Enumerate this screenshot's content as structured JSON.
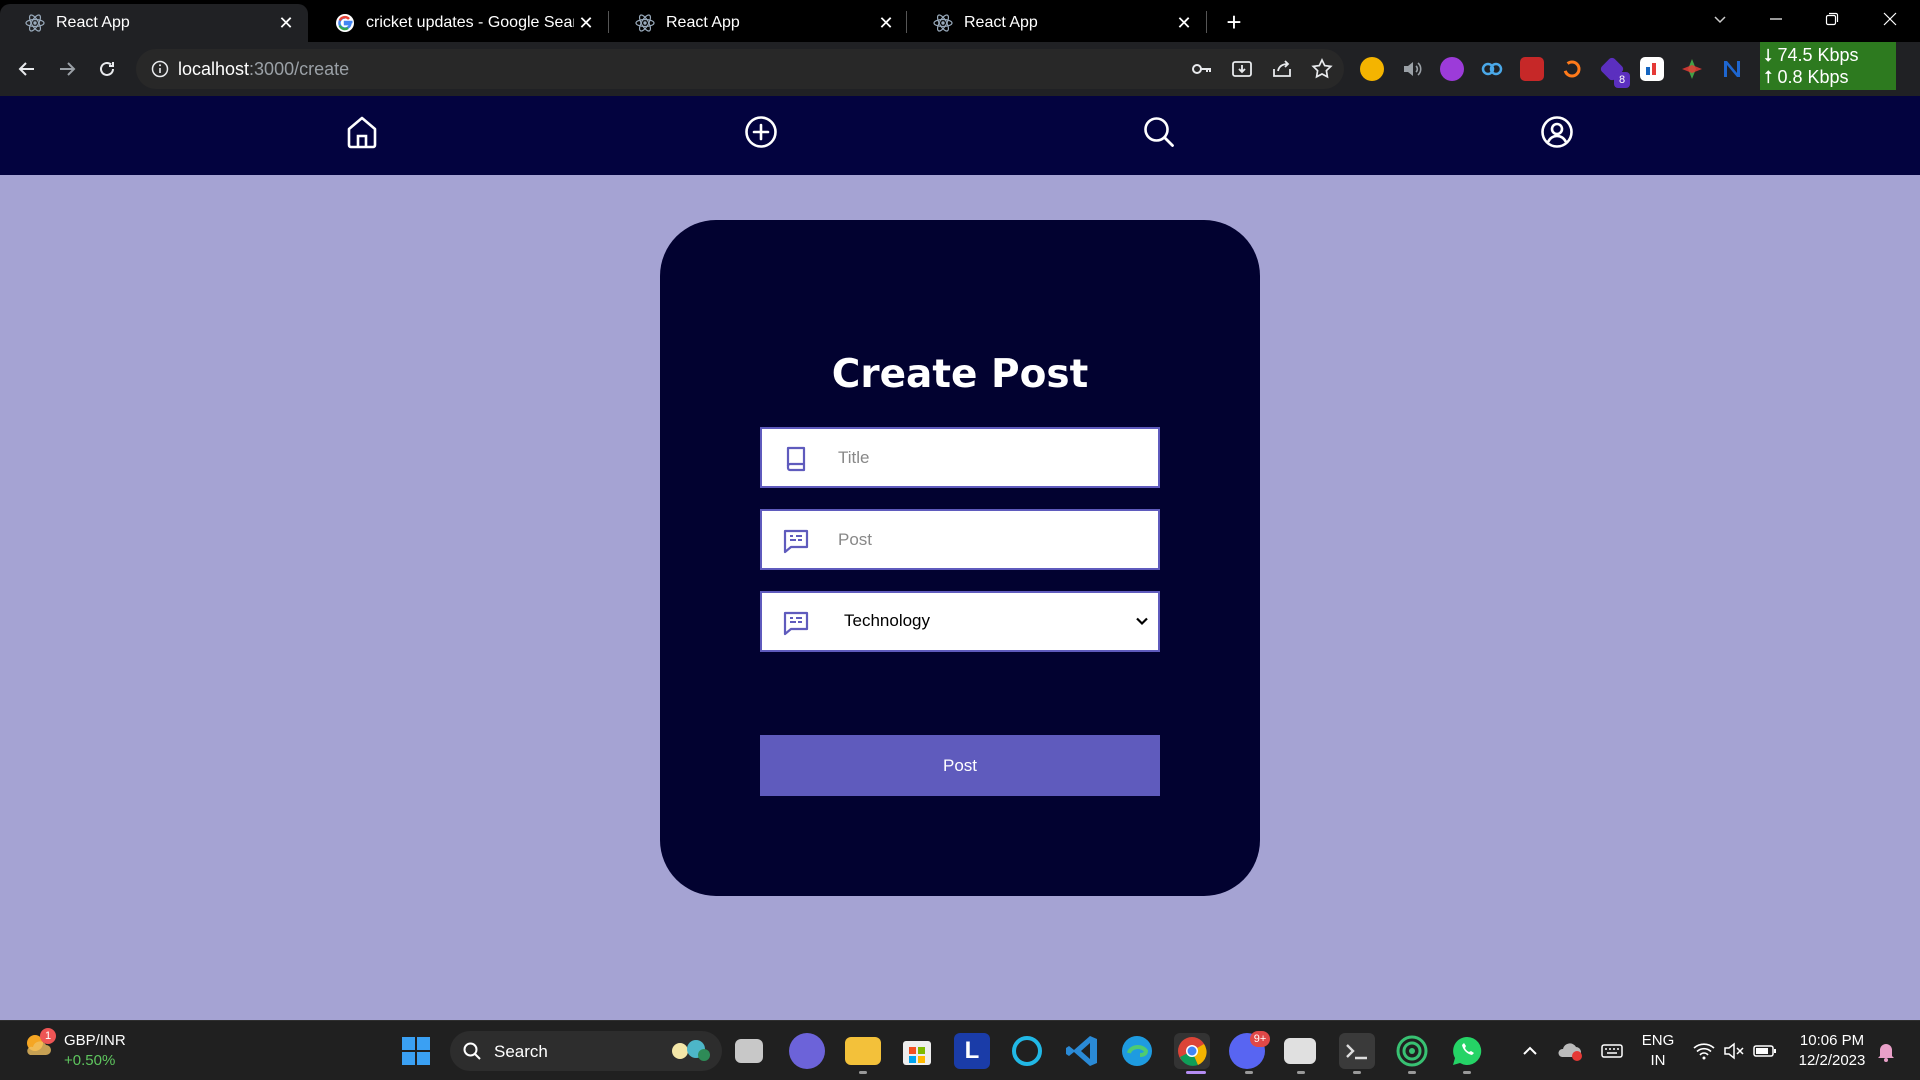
{
  "browser": {
    "tabs": [
      {
        "title": "React App",
        "icon": "react-icon",
        "active": true
      },
      {
        "title": "cricket updates - Google Search",
        "icon": "google-icon",
        "active": false
      },
      {
        "title": "React App",
        "icon": "react-icon",
        "active": false
      },
      {
        "title": "React App",
        "icon": "react-icon",
        "active": false
      }
    ],
    "url_host": "localhost",
    "url_path": ":3000/create",
    "net_down": "⭣ 74.5 Kbps",
    "net_up": "⭡ 0.8 Kbps",
    "ext_badge": "8"
  },
  "app": {
    "nav": [
      "home-icon",
      "plus-circle-icon",
      "search-icon",
      "user-circle-icon"
    ],
    "nav_bg": "#03033f"
  },
  "form": {
    "title": "Create Post",
    "title_placeholder": "Title",
    "post_placeholder": "Post",
    "category_value": "Technology",
    "submit_label": "Post",
    "accent": "#5f5bbd",
    "card_bg": "#020230",
    "page_bg": "#a5a3d3"
  },
  "taskbar": {
    "weather_badge": "1",
    "ticker_name": "GBP/INR",
    "ticker_change": "+0.50%",
    "search_label": "Search",
    "discord_badge": "9+",
    "lang_top": "ENG",
    "lang_bottom": "IN",
    "time": "10:06 PM",
    "date": "12/2/2023"
  }
}
